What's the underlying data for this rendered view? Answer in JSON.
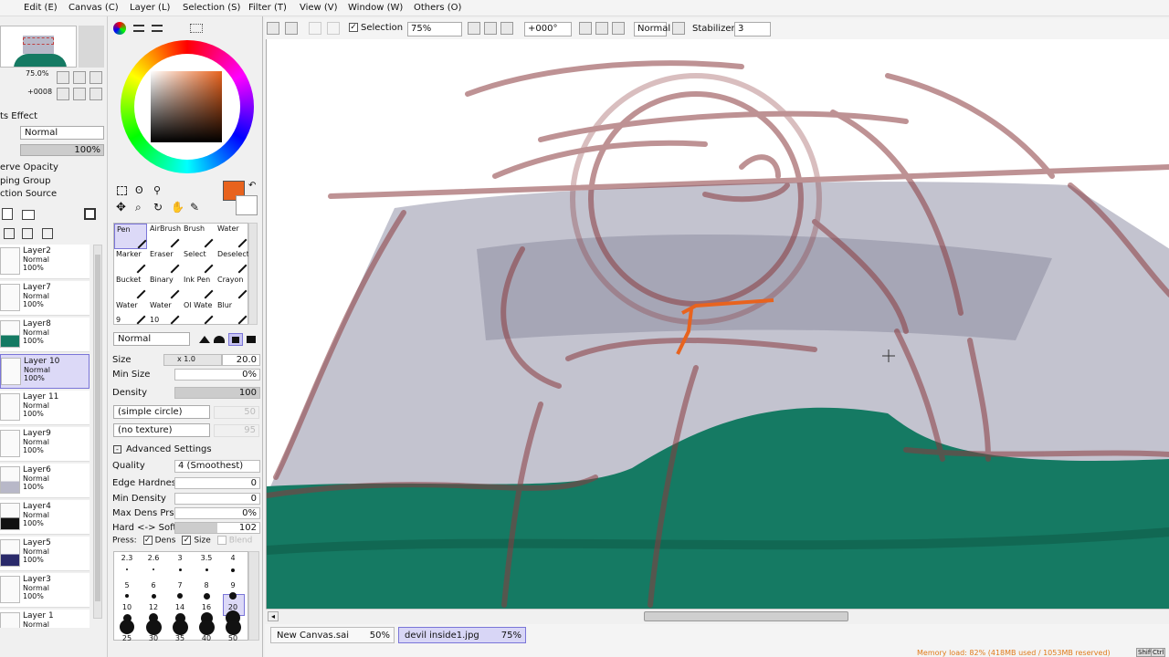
{
  "menu": [
    "Edit (E)",
    "Canvas (C)",
    "Layer (L)",
    "Selection (S)",
    "Filter (T)",
    "View (V)",
    "Window (W)",
    "Others (O)"
  ],
  "toolbar": {
    "selection_label": "Selection",
    "zoom": "75%",
    "rotation": "+000°",
    "mode": "Normal",
    "stabilizer_label": "Stabilizer",
    "stabilizer_value": "3"
  },
  "navigator": {
    "zoom": "75.0%",
    "rotation": "+0008"
  },
  "layer_panel": {
    "effect_label": "ts Effect",
    "blend_mode": "Normal",
    "opacity": "100%",
    "options": [
      "erve Opacity",
      "ping Group",
      "ction Source"
    ],
    "layers": [
      {
        "name": "Layer2",
        "mode": "Normal",
        "opacity": "100%"
      },
      {
        "name": "Layer7",
        "mode": "Normal",
        "opacity": "100%"
      },
      {
        "name": "Layer8",
        "mode": "Normal",
        "opacity": "100%"
      },
      {
        "name": "Layer 10",
        "mode": "Normal",
        "opacity": "100%"
      },
      {
        "name": "Layer 11",
        "mode": "Normal",
        "opacity": "100%"
      },
      {
        "name": "Layer9",
        "mode": "Normal",
        "opacity": "100%"
      },
      {
        "name": "Layer6",
        "mode": "Normal",
        "opacity": "100%"
      },
      {
        "name": "Layer4",
        "mode": "Normal",
        "opacity": "100%"
      },
      {
        "name": "Layer5",
        "mode": "Normal",
        "opacity": "100%"
      },
      {
        "name": "Layer3",
        "mode": "Normal",
        "opacity": "100%"
      },
      {
        "name": "Layer 1",
        "mode": "Normal",
        "opacity": ""
      }
    ]
  },
  "colors": {
    "primary": "#e8631e",
    "secondary": "#ffffff",
    "canvas_bg": "#ffffff",
    "teal": "#157a63",
    "sketch": "#8a3a3e"
  },
  "brushes": [
    {
      "name": "Pen",
      "sub": ""
    },
    {
      "name": "AirBrush",
      "sub": ""
    },
    {
      "name": "Brush",
      "sub": ""
    },
    {
      "name": "Water",
      "sub": ""
    },
    {
      "name": "Marker",
      "sub": ""
    },
    {
      "name": "Eraser",
      "sub": ""
    },
    {
      "name": "Select",
      "sub": ""
    },
    {
      "name": "Deselect",
      "sub": ""
    },
    {
      "name": "Bucket",
      "sub": ""
    },
    {
      "name": "Binary",
      "sub": ""
    },
    {
      "name": "Ink Pen",
      "sub": ""
    },
    {
      "name": "Crayon",
      "sub": ""
    },
    {
      "name": "Water",
      "sub": "9"
    },
    {
      "name": "Water",
      "sub": "10"
    },
    {
      "name": "Ol Wate",
      "sub": ""
    },
    {
      "name": "Blur",
      "sub": ""
    }
  ],
  "tool_options": {
    "blend_mode": "Normal",
    "size_label": "Size",
    "size_mult": "x 1.0",
    "size_value": "20.0",
    "min_size_label": "Min Size",
    "min_size_value": "0%",
    "density_label": "Density",
    "density_value": "100",
    "shape": "(simple circle)",
    "shape_value": "50",
    "texture": "(no texture)",
    "texture_value": "95",
    "advanced_label": "Advanced Settings",
    "quality_label": "Quality",
    "quality_value": "4 (Smoothest)",
    "edge_label": "Edge Hardness",
    "edge_value": "0",
    "min_density_label": "Min Density",
    "min_density_value": "0",
    "max_dens_label": "Max Dens Prs.",
    "max_dens_value": "0%",
    "hard_soft_label": "Hard <-> Soft",
    "hard_soft_value": "102",
    "press_label": "Press:",
    "dens_label": "Dens",
    "size_chk_label": "Size",
    "blend_label": "Blend"
  },
  "brush_sizes": {
    "row1": [
      "2.3",
      "2.6",
      "3",
      "3.5",
      "4"
    ],
    "row2": [
      "5",
      "6",
      "7",
      "8",
      "9"
    ],
    "row3": [
      "10",
      "12",
      "14",
      "16",
      "20"
    ],
    "row4": [
      "25",
      "30",
      "35",
      "40",
      "50"
    ]
  },
  "canvas_tabs": [
    {
      "name": "New Canvas.sai",
      "zoom": "50%"
    },
    {
      "name": "devil inside1.jpg",
      "zoom": "75%"
    }
  ],
  "memory": "Memory load: 82% (418MB used / 1053MB reserved)",
  "keys": [
    "Shift",
    "Ctrl"
  ]
}
